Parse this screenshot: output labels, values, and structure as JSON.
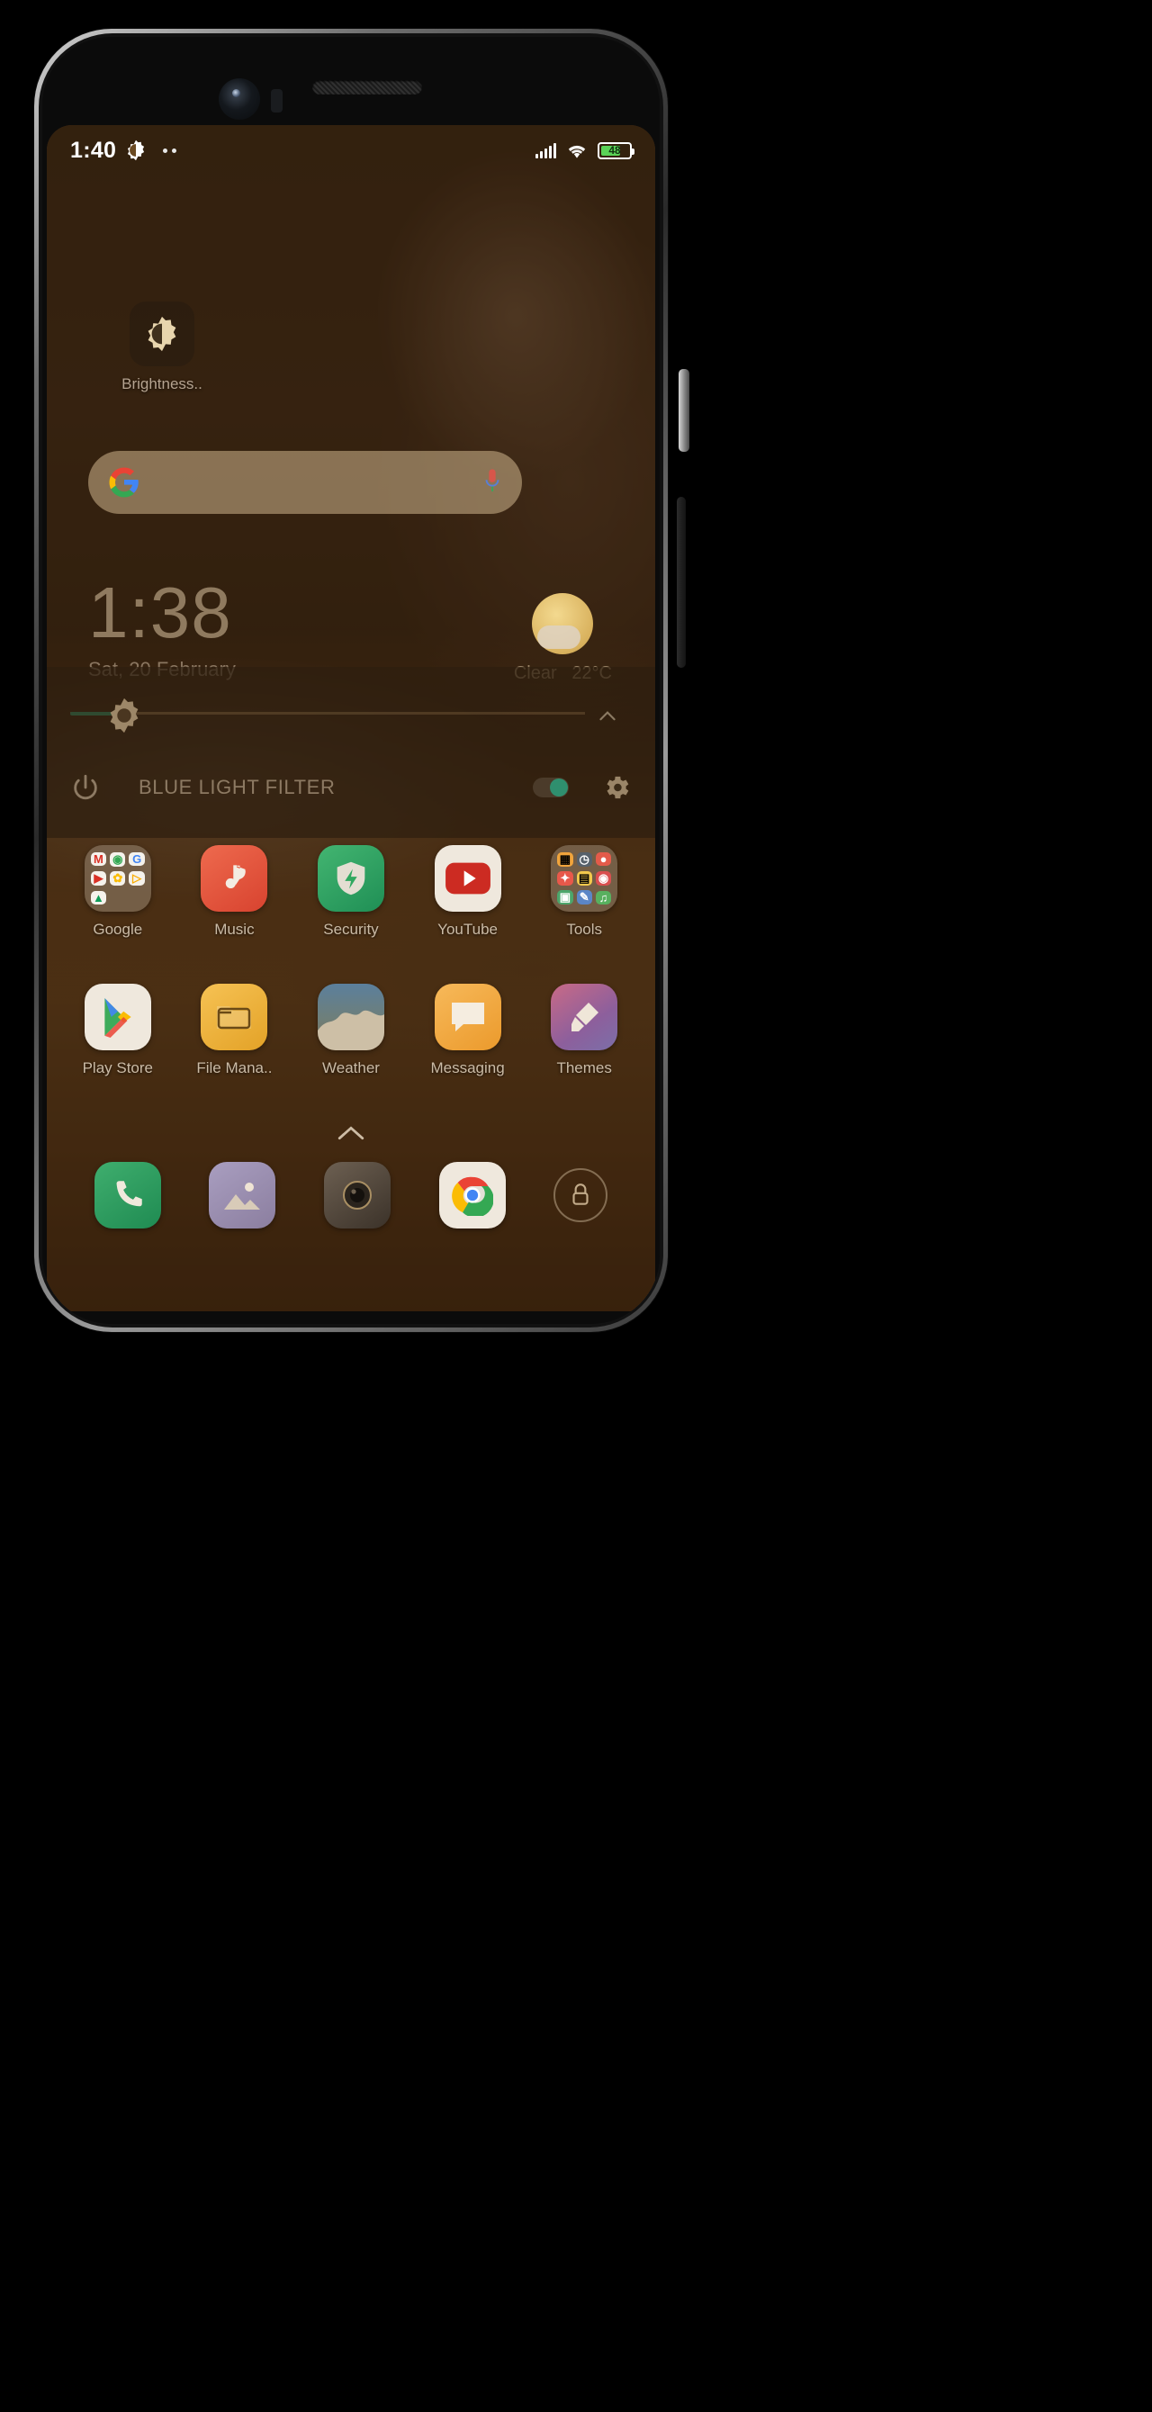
{
  "device": {
    "frame": "android-phone-mockup"
  },
  "status_bar": {
    "time": "1:40",
    "icons": [
      "blue-light-filter-icon",
      "more-dots-icon",
      "signal-icon",
      "wifi-icon",
      "battery-icon"
    ],
    "battery_percent": "48",
    "battery_color": "#5ad257"
  },
  "shortcut": {
    "label": "Brightness..",
    "icon": "brightness-sun-moon-icon"
  },
  "search_widget": {
    "placeholder": "",
    "left_icon": "google-g-icon",
    "right_icon": "microphone-icon"
  },
  "clock_widget": {
    "time": "1:38",
    "date": "Sat, 20 February",
    "weather_condition": "Clear",
    "weather_temp": "22°C",
    "weather_icon": "partly-cloudy-sun-icon"
  },
  "blue_light_panel": {
    "title": "BLUE LIGHT FILTER",
    "power_icon": "power-icon",
    "settings_icon": "gear-icon",
    "collapse_icon": "chevron-up-icon",
    "brightness_icon": "sun-slider-icon",
    "toggle_on": true,
    "toggle_color": "#2f8f6e",
    "slider_fill_color": "#2f4a30"
  },
  "home_screen": {
    "rows": [
      [
        {
          "label": "Google",
          "icon": "google-folder-icon",
          "type": "folder",
          "children": [
            "gmail-icon",
            "maps-icon",
            "google-search-icon",
            "gmail-video-icon",
            "photos-icon",
            "play-icon",
            "drive-icon"
          ]
        },
        {
          "label": "Music",
          "icon": "music-note-icon",
          "type": "app",
          "color": "#e4553c"
        },
        {
          "label": "Security",
          "icon": "shield-bolt-icon",
          "type": "app",
          "color": "#2e9d5f"
        },
        {
          "label": "YouTube",
          "icon": "youtube-play-icon",
          "type": "app",
          "color": "#ffffff"
        },
        {
          "label": "Tools",
          "icon": "tools-folder-icon",
          "type": "folder",
          "children": [
            "calc-icon",
            "clock-icon",
            "rec-icon",
            "compass-icon",
            "notes-icon",
            "scan-icon",
            "calendar-icon",
            "mi-icon",
            "fm-icon"
          ]
        }
      ],
      [
        {
          "label": "Play Store",
          "icon": "play-store-icon",
          "type": "app",
          "color": "#ffffff"
        },
        {
          "label": "File Mana..",
          "icon": "file-manager-folder-icon",
          "type": "app",
          "color": "#f0b429"
        },
        {
          "label": "Weather",
          "icon": "weather-icon",
          "type": "app",
          "color": "#3e6f96"
        },
        {
          "label": "Messaging",
          "icon": "messaging-bubble-icon",
          "type": "app",
          "color": "#f3a93c"
        },
        {
          "label": "Themes",
          "icon": "themes-brush-icon",
          "type": "app",
          "color": "#c05c78"
        }
      ]
    ],
    "page_indicator_icon": "chevron-up-icon"
  },
  "dock": {
    "items": [
      {
        "label": "",
        "icon": "phone-icon",
        "color": "#2e9d5f"
      },
      {
        "label": "",
        "icon": "gallery-icon",
        "color": "#8d7fa8"
      },
      {
        "label": "",
        "icon": "camera-icon",
        "color": "#4a4a4a"
      },
      {
        "label": "",
        "icon": "chrome-icon",
        "color": "#ffffff"
      },
      {
        "label": "",
        "icon": "lock-icon",
        "color": "transparent"
      }
    ]
  }
}
